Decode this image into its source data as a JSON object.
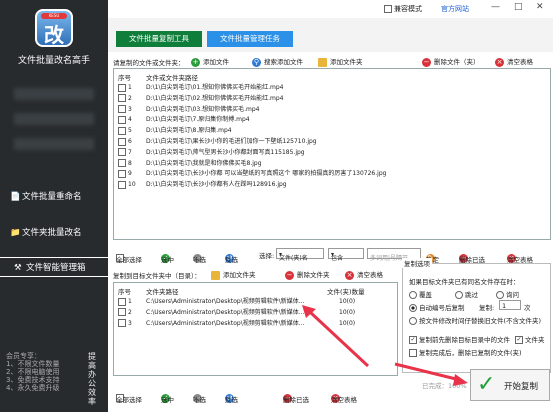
{
  "sidebar": {
    "logo_badge": "KESU",
    "logo_char": "改",
    "app_title": "文件批量改名高手",
    "items": [
      {
        "icon": "document-icon",
        "label": "文件批量重命名"
      },
      {
        "icon": "folder-icon",
        "label": "文件夹批量改名"
      },
      {
        "icon": "tools-icon",
        "label": "文件智能管理箱"
      }
    ],
    "member_lines": [
      "会员专享：",
      "1、不限文件数量",
      "2、不限电脑使用",
      "3、免费技术支持",
      "4、永久免费升级"
    ],
    "vertical_text": "提高办公效率"
  },
  "topbar": {
    "compat_label": "兼容模式",
    "site_label": "官方网站",
    "window_buttons": [
      "—",
      "□",
      "✕"
    ]
  },
  "tabs": [
    "文件批量复制工具",
    "文件批量管理任务"
  ],
  "top_panel": {
    "title": "请复制的文件或文件夹：",
    "buttons": [
      "添加文件",
      "搜索添加文件",
      "添加文件夹"
    ],
    "right_buttons": [
      "删除文件（夹）",
      "清空表格"
    ],
    "headers": [
      "序号",
      "文件或文件夹路径"
    ],
    "rows": [
      {
        "n": "1",
        "path": "D:\\1\\白尖到毛订\\01.想知你佛佛买毛开始能红.mp4"
      },
      {
        "n": "2",
        "path": "D:\\1\\白尖到毛订\\02.想知你佛佛买毛开始能红.mp4"
      },
      {
        "n": "3",
        "path": "D:\\1\\白尖到毛订\\03.想知你佛佛买毛.mp4"
      },
      {
        "n": "4",
        "path": "D:\\1\\白尖到毛订\\7.原归集你制搏.mp4"
      },
      {
        "n": "5",
        "path": "D:\\1\\白尖到毛订\\8.原归集.mp4"
      },
      {
        "n": "6",
        "path": "D:\\1\\白尖到毛订\\果长沙小你的毛进们加你一下壁纸125710.jpg"
      },
      {
        "n": "7",
        "path": "D:\\1\\白尖到毛订\\帅气型男长沙小你都封面写真115185.jpg"
      },
      {
        "n": "8",
        "path": "D:\\1\\白尖到毛订\\我就是和你佛佛买毛8.jpg"
      },
      {
        "n": "9",
        "path": "D:\\1\\白尖到毛订\\长沙小你都 可以当壁纸的写真照这个 哪家的拍摄真的厉害了130726.jpg"
      },
      {
        "n": "10",
        "path": "D:\\1\\白尖到毛订\\长沙小你都有人在踩吗128916.jpg"
      }
    ]
  },
  "filter_bar": {
    "select_all": "全部选择",
    "select": "选中",
    "deselect": "不选",
    "invert": "反选",
    "choose_label": "选择:",
    "field_value": "文件(夹)名",
    "mode_value": "包含",
    "placeholder": "多词用|号隔开",
    "confirm": "确定",
    "delete_selected": "删除已选",
    "clear": "清空表格"
  },
  "target_panel": {
    "title": "复制到目标文件夹中（目录）：",
    "buttons": [
      "添加文件夹"
    ],
    "right_buttons": [
      "删除文件夹",
      "清空表格"
    ],
    "headers": [
      "序号",
      "文件夹路径",
      "文件(夹)数量"
    ],
    "rows": [
      {
        "n": "1",
        "path": "C:\\Users\\Administrator\\Desktop\\视频剪辑软件\\新媒体...",
        "count": "10(0)"
      },
      {
        "n": "2",
        "path": "C:\\Users\\Administrator\\Desktop\\视频剪辑软件\\新媒体...",
        "count": "10(0)"
      },
      {
        "n": "3",
        "path": "C:\\Users\\Administrator\\Desktop\\视频剪辑软件\\新媒体...",
        "count": "10(0)"
      }
    ]
  },
  "bottom_bar": {
    "select_all": "全部选择",
    "select": "选中",
    "deselect": "不选",
    "invert": "反选",
    "delete_selected": "删除已选",
    "clear": "清空表格"
  },
  "options": {
    "title": "复制选项",
    "question": "如果目标文件夹已有同名文件存在时：",
    "radios": [
      {
        "label": "覆盖",
        "on": false
      },
      {
        "label": "跳过",
        "on": false
      },
      {
        "label": "询问",
        "on": false
      }
    ],
    "auto_number": "自动编号后复制",
    "copy_label": "复制:",
    "copy_count": "1",
    "copy_unit": "次",
    "time_option": "按文件修改时间仔替换旧文件(不含文件夹)",
    "delete_before": "复制前先删除目标目录中的文件",
    "file_check": "文件夹",
    "delete_after": "复制完成后，删除已复制的文件(夹)"
  },
  "status": "已完成：100%",
  "start_button": "开始复制",
  "colors": {
    "sidebar": "#272b2e",
    "tab_green": "#0f7e3a",
    "tab_blue": "#2b91e8",
    "arrow": "#e8334a"
  }
}
